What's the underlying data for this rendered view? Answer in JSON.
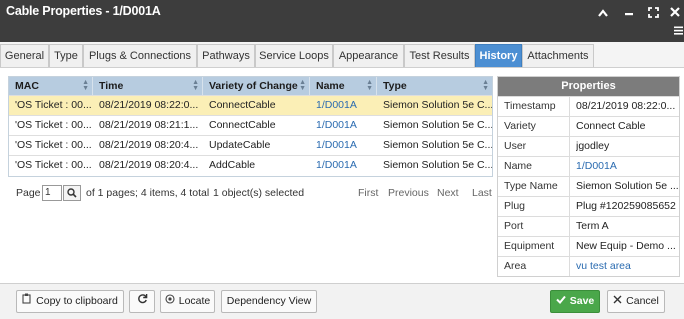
{
  "window": {
    "title": "Cable Properties - 1/D001A",
    "icons": [
      "chevron-up-icon",
      "minimize-icon",
      "maximize-icon",
      "close-icon",
      "menu-icon"
    ]
  },
  "tabs": [
    {
      "label": "General",
      "active": false
    },
    {
      "label": "Type",
      "active": false
    },
    {
      "label": "Plugs & Connections",
      "active": false
    },
    {
      "label": "Pathways",
      "active": false
    },
    {
      "label": "Service Loops",
      "active": false
    },
    {
      "label": "Appearance",
      "active": false
    },
    {
      "label": "Test Results",
      "active": false
    },
    {
      "label": "History",
      "active": true
    },
    {
      "label": "Attachments",
      "active": false
    }
  ],
  "history": {
    "columns": [
      "MAC",
      "Time",
      "Variety of Change",
      "Name",
      "Type"
    ],
    "rows": [
      [
        "'OS Ticket : 00...",
        "08/21/2019 08:22:0...",
        "ConnectCable",
        "1/D001A",
        "Siemon Solution 5e C..."
      ],
      [
        "'OS Ticket : 00...",
        "08/21/2019 08:21:1...",
        "ConnectCable",
        "1/D001A",
        "Siemon Solution 5e C..."
      ],
      [
        "'OS Ticket : 00...",
        "08/21/2019 08:20:4...",
        "UpdateCable",
        "1/D001A",
        "Siemon Solution 5e C..."
      ],
      [
        "'OS Ticket : 00...",
        "08/21/2019 08:20:4...",
        "AddCable",
        "1/D001A",
        "Siemon Solution 5e C..."
      ]
    ],
    "selected_row": 0
  },
  "pager": {
    "page_label": "Page",
    "page_value": "1",
    "of_text": "of 1 pages; 4 items, 4 total",
    "selected_text": "1 object(s) selected",
    "first": "First",
    "previous": "Previous",
    "next": "Next",
    "last": "Last",
    "search_icon": "magnifier-icon"
  },
  "properties": {
    "title": "Properties",
    "rows": [
      {
        "key": "Timestamp",
        "value": "08/21/2019 08:22:0..."
      },
      {
        "key": "Variety",
        "value": "Connect Cable"
      },
      {
        "key": "User",
        "value": "jgodley"
      },
      {
        "key": "Name",
        "value": "1/D001A",
        "link": true
      },
      {
        "key": "Type Name",
        "value": "Siemon Solution 5e ..."
      },
      {
        "key": "Plug",
        "value": "Plug #120259085652"
      },
      {
        "key": "Port",
        "value": "Term A"
      },
      {
        "key": "Equipment",
        "value": "New Equip - Demo ..."
      },
      {
        "key": "Area",
        "value": "vu test area",
        "link": true
      }
    ]
  },
  "footer": {
    "copy_label": "Copy to clipboard",
    "locate_label": "Locate",
    "dependency_label": "Dependency View",
    "save_label": "Save",
    "cancel_label": "Cancel"
  },
  "colors": {
    "title_bar": "#3d3d3d",
    "active_tab": "#4c8fd3",
    "grid_header": "#b7cce0",
    "selected_row": "#fbefb6",
    "link": "#2a6bb0",
    "save_button": "#4aa74a"
  }
}
